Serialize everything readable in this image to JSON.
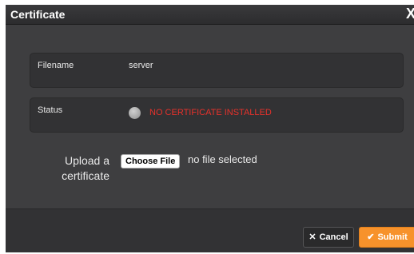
{
  "dialog": {
    "title": "Certificate",
    "close_glyph": "X"
  },
  "filename_row": {
    "label": "Filename",
    "value": "server"
  },
  "status_row": {
    "label": "Status",
    "value": "NO CERTIFICATE INSTALLED",
    "status_color": "#e8312b"
  },
  "upload": {
    "label_line1": "Upload a",
    "label_line2": "certificate",
    "button_label": "Choose File",
    "file_status": "no file selected"
  },
  "footer": {
    "cancel_label": "Cancel",
    "submit_label": "Submit",
    "cancel_icon": "x-icon",
    "submit_icon": "check-icon",
    "accent_color": "#f7922b"
  }
}
